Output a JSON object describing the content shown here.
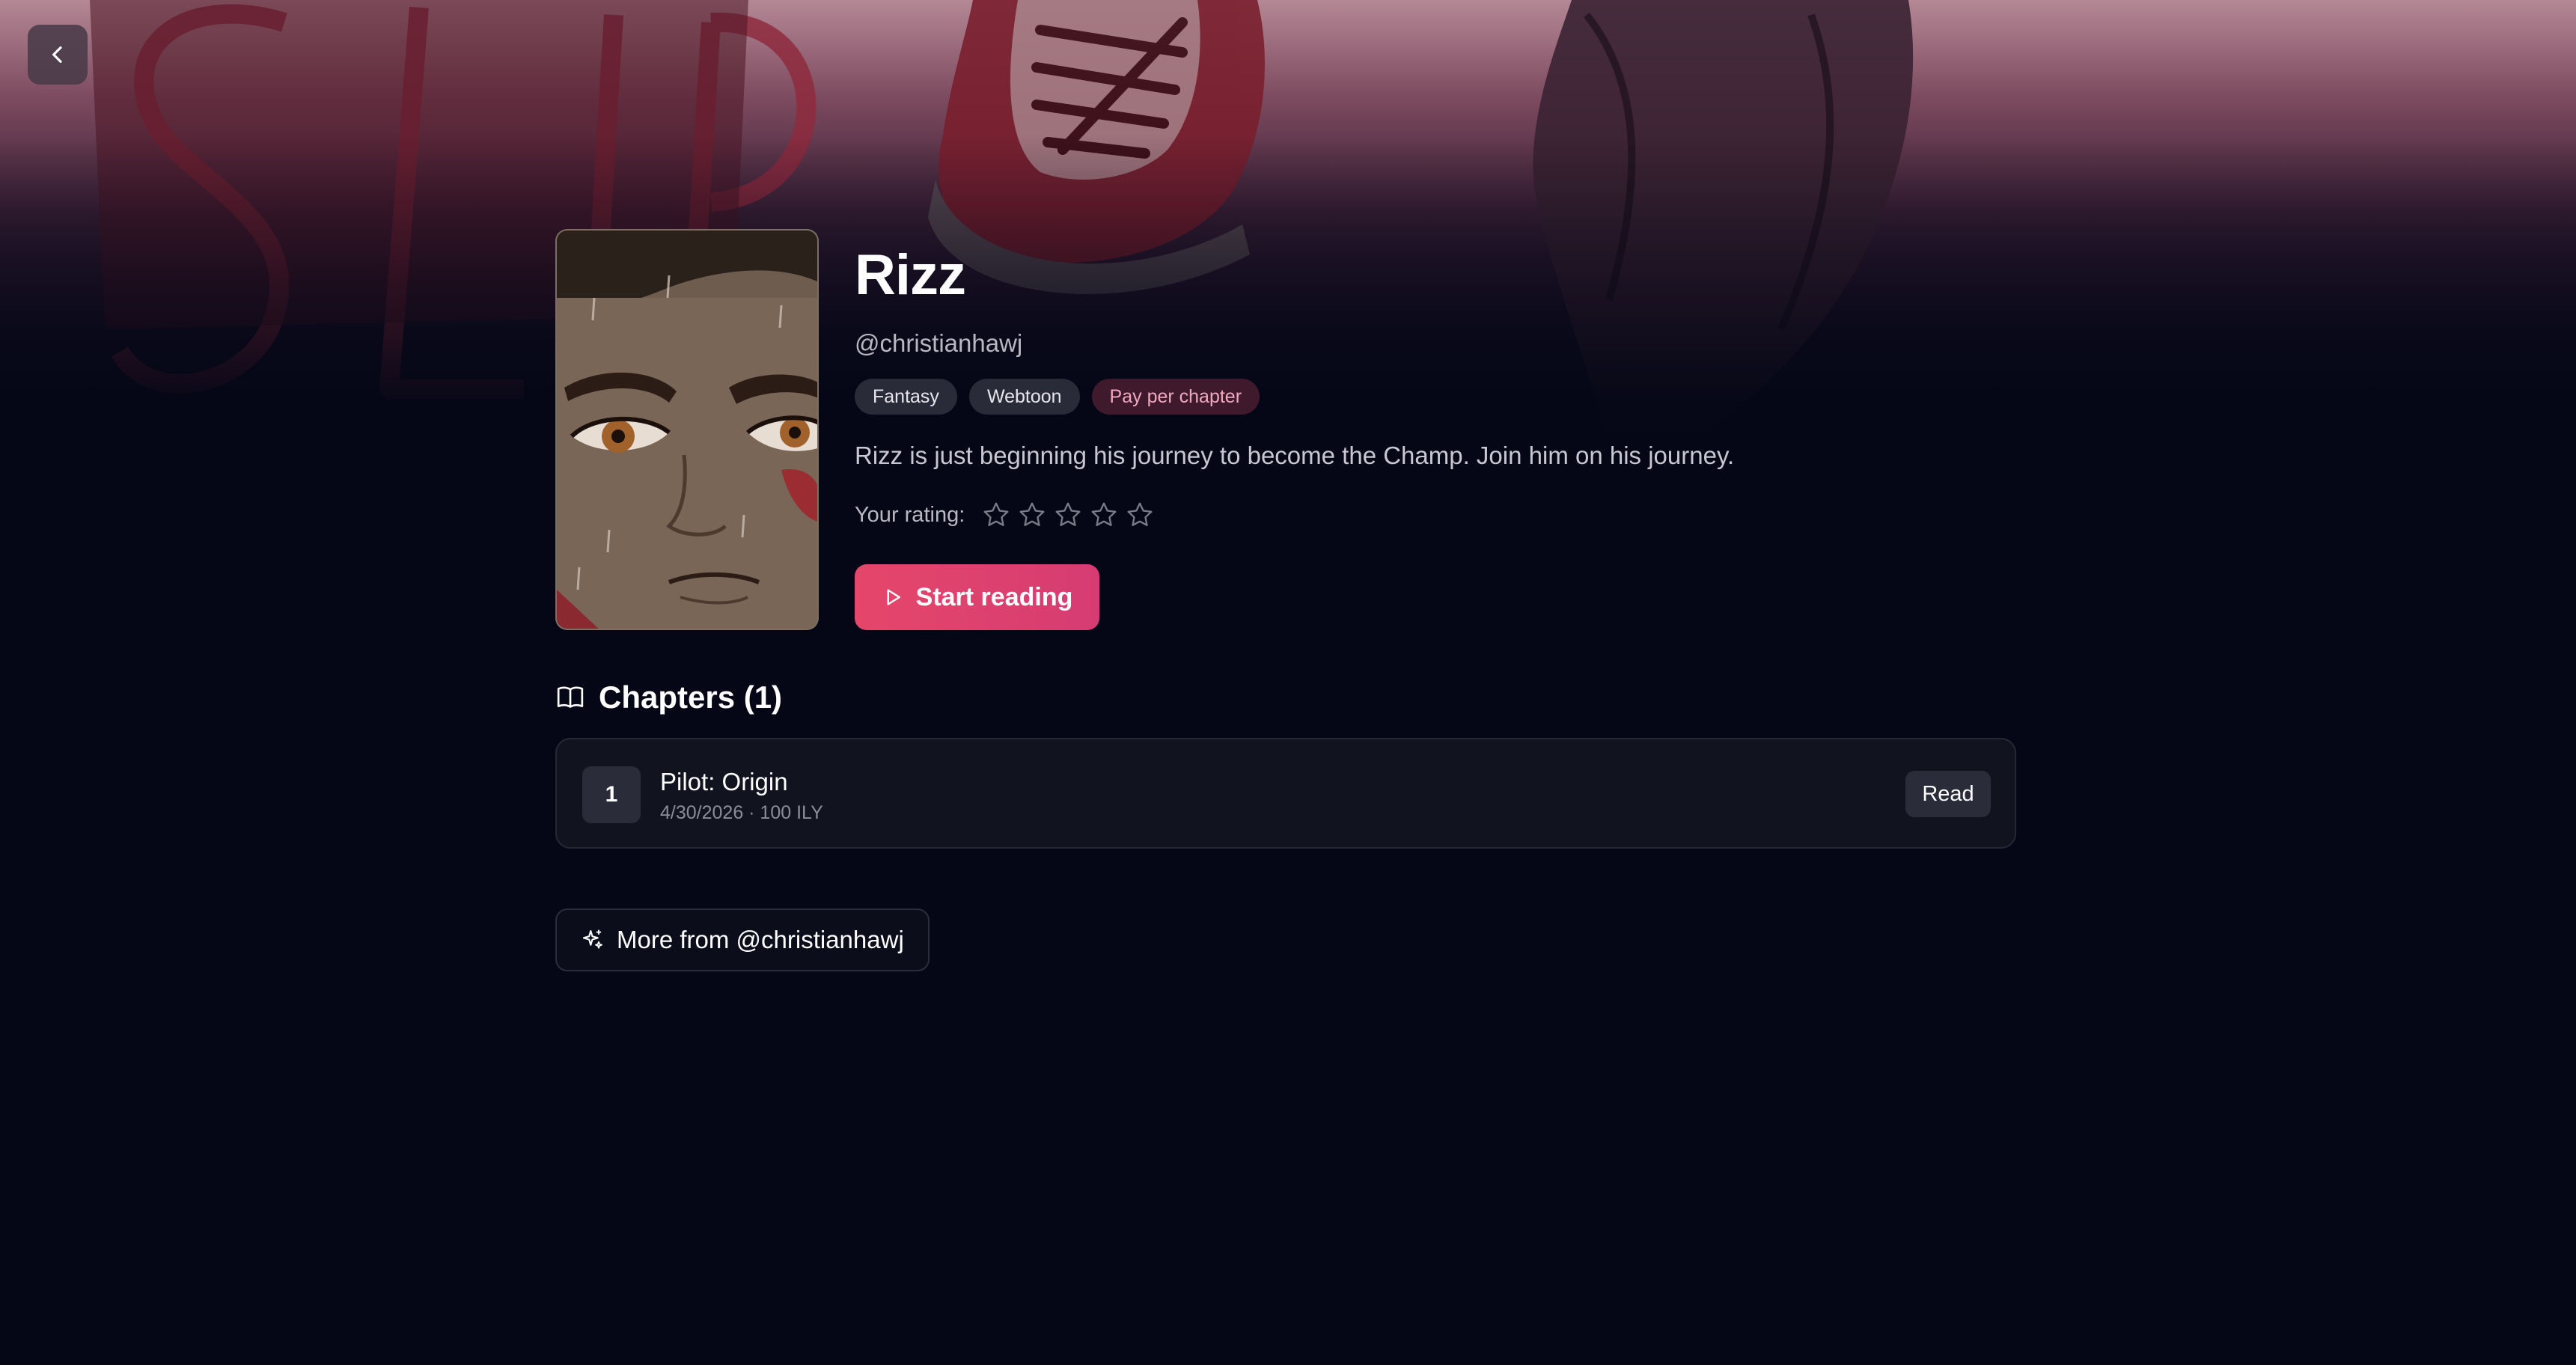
{
  "navigation": {
    "back_icon": "chevron-left-icon"
  },
  "series": {
    "title": "Rizz",
    "author": "@christianhawj",
    "tags": [
      {
        "label": "Fantasy"
      },
      {
        "label": "Webtoon"
      },
      {
        "label": "Pay per chapter"
      }
    ],
    "description": "Rizz is just beginning his journey to become the Champ. Join him on his journey."
  },
  "rating": {
    "label": "Your rating:",
    "max_stars": 5,
    "value": 0
  },
  "actions": {
    "start_reading_label": "Start reading",
    "start_reading_icon": "play-icon"
  },
  "chapters": {
    "heading": "Chapters (1)",
    "heading_icon": "book-open-icon",
    "items": [
      {
        "number": "1",
        "title": "Pilot: Origin",
        "meta": "4/30/2026 · 100 ILY",
        "action_label": "Read"
      }
    ]
  },
  "more": {
    "label": "More from @christianhawj",
    "icon": "sparkles-icon"
  },
  "colors": {
    "background": "#050716",
    "accent": "#e5466a",
    "paid_tag_text": "#f1a8bf"
  }
}
